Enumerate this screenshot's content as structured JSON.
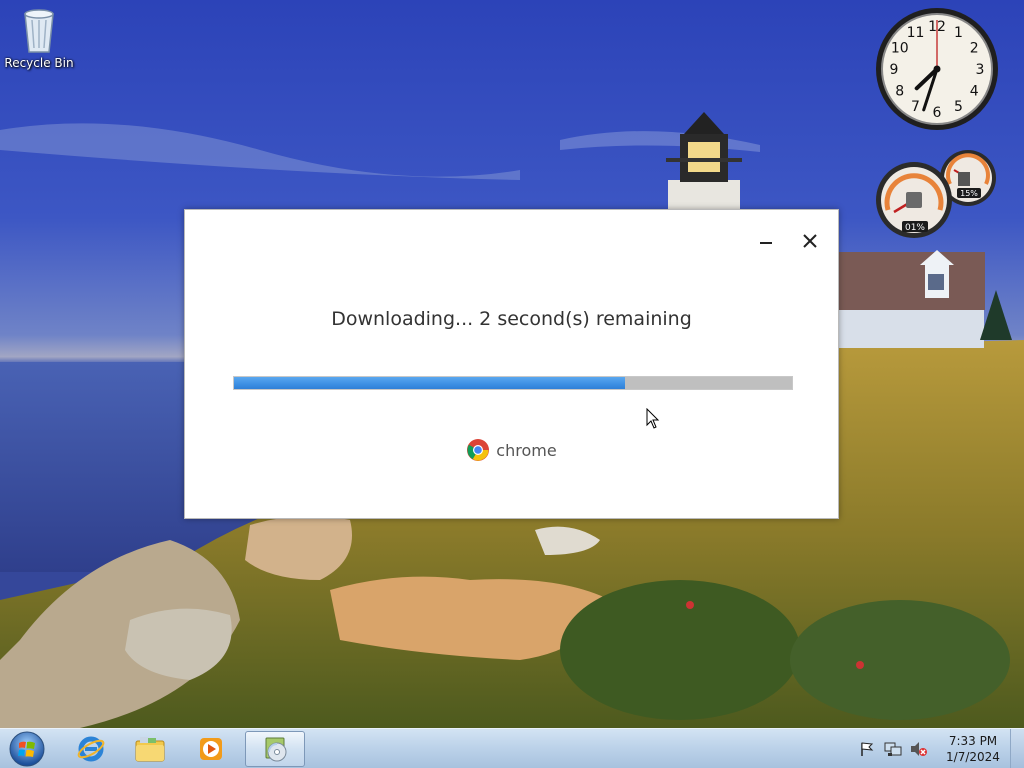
{
  "desktop": {
    "icons": [
      {
        "label": "Recycle Bin",
        "icon": "recycle-bin-icon"
      }
    ]
  },
  "gadgets": {
    "clock": {
      "hour": 7,
      "minute": 33,
      "second": 0,
      "numerals": [
        "12",
        "1",
        "2",
        "3",
        "4",
        "5",
        "6",
        "7",
        "8",
        "9",
        "10",
        "11"
      ]
    },
    "cpu_meter": {
      "cpu_percent": 1,
      "cpu_label": "01%",
      "memory_percent": 15,
      "memory_label": "15%"
    }
  },
  "installer": {
    "status": "Downloading... 2 second(s) remaining",
    "progress": 0.7,
    "brand": "chrome",
    "minimize_icon": "minimize-icon",
    "close_icon": "close-icon"
  },
  "taskbar": {
    "start": "windows-start-orb-icon",
    "pinned": [
      {
        "name": "internet-explorer",
        "icon": "internet-explorer-icon"
      },
      {
        "name": "windows-explorer",
        "icon": "folder-library-icon"
      },
      {
        "name": "windows-media-player",
        "icon": "media-player-icon"
      },
      {
        "name": "installer",
        "icon": "installer-cd-icon",
        "active": true
      }
    ],
    "tray": {
      "icons": [
        "action-center-flag-icon",
        "network-icon",
        "volume-muted-icon"
      ],
      "time": "7:33 PM",
      "date": "1/7/2024"
    }
  },
  "colors": {
    "progress": "#3d8fe3",
    "progress_track": "#bfbfbf",
    "taskbar": "#bdd3ea"
  }
}
